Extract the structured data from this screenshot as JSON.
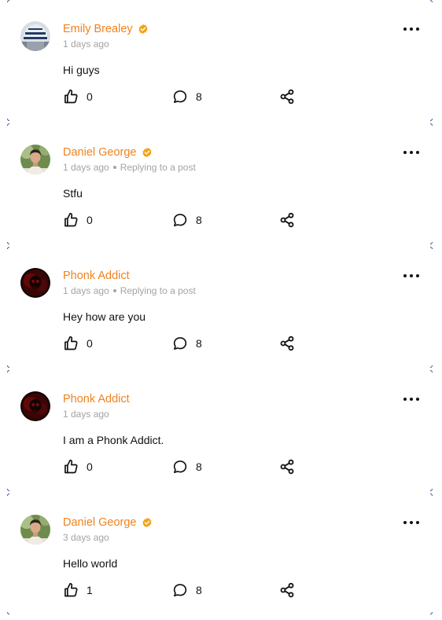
{
  "colors": {
    "author": "#f0821f",
    "verified_badge": "#f5a216",
    "meta_text": "#a3a3a3",
    "body_text": "#111111"
  },
  "icons": {
    "verified": "verified-badge-icon",
    "more": "more-horizontal-icon",
    "like": "thumbs-up-icon",
    "comment": "comment-bubble-icon",
    "share": "share-icon"
  },
  "posts": [
    {
      "author": "Emily Brealey",
      "verified": true,
      "avatar": "striped-blue-hat",
      "time": "1 days ago",
      "reply_note": "",
      "text": "Hi guys",
      "likes": "0",
      "comments": "8"
    },
    {
      "author": "Daniel George",
      "verified": true,
      "avatar": "portrait-green-background",
      "time": "1 days ago",
      "reply_note": "Replying to a post",
      "text": "Stfu",
      "likes": "0",
      "comments": "8"
    },
    {
      "author": "Phonk Addict",
      "verified": false,
      "avatar": "dark-red-skull",
      "time": "1 days ago",
      "reply_note": "Replying to a post",
      "text": "Hey how are you",
      "likes": "0",
      "comments": "8"
    },
    {
      "author": "Phonk Addict",
      "verified": false,
      "avatar": "dark-red-skull",
      "time": "1 days ago",
      "reply_note": "",
      "text": "I am a Phonk Addict.",
      "likes": "0",
      "comments": "8"
    },
    {
      "author": "Daniel George",
      "verified": true,
      "avatar": "portrait-green-background",
      "time": "3 days ago",
      "reply_note": "",
      "text": "Hello world",
      "likes": "1",
      "comments": "8"
    }
  ]
}
